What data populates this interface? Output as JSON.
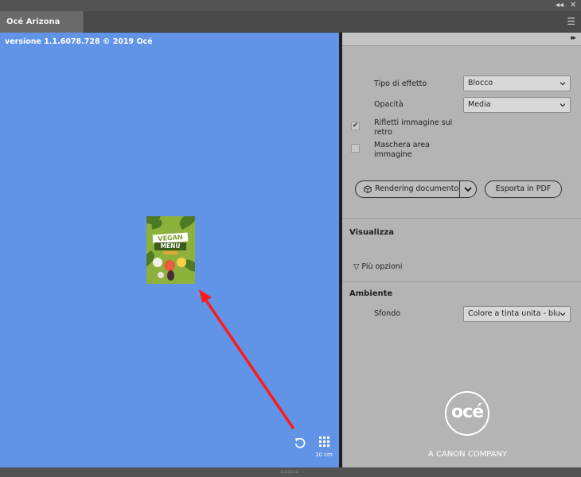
{
  "window": {
    "collapse_icon": "double-chevron-left",
    "close_icon": "close",
    "menu_icon": "hamburger"
  },
  "tab": {
    "title": "Océ Arizona Xpert"
  },
  "canvas": {
    "version_text": "versione 1.1.6078.728 © 2019 Océ",
    "background_color": "#6193e6",
    "thumbnail": {
      "line1": "VEGAN",
      "line2": "MENU",
      "bg_color": "#8cb23c"
    },
    "annotation_arrow_color": "#ff1a1a",
    "reset_icon": "rotate-ccw",
    "grid_icon": "grid-3x3",
    "scale_label": "10 cm"
  },
  "panel": {
    "expand_icon": "double-chevron-right",
    "effect_type": {
      "label": "Tipo di effetto",
      "value": "Blocco"
    },
    "opacity": {
      "label": "Opacità",
      "value": "Media"
    },
    "mirror": {
      "label": "Rifletti immagine sul retro",
      "checked": true
    },
    "mask": {
      "label": "Maschera area immagine",
      "checked": false
    },
    "render_button": {
      "label": "Rendering documento",
      "icon": "cube"
    },
    "export_button": {
      "label": "Esporta in PDF"
    },
    "view": {
      "heading": "Visualizza",
      "more_options": "Più opzioni"
    },
    "environment": {
      "heading": "Ambiente",
      "background": {
        "label": "Sfondo",
        "value": "Colore a tinta unita - blu"
      }
    },
    "brand": {
      "logo_text": "océ",
      "tagline": "A CANON COMPANY"
    }
  }
}
